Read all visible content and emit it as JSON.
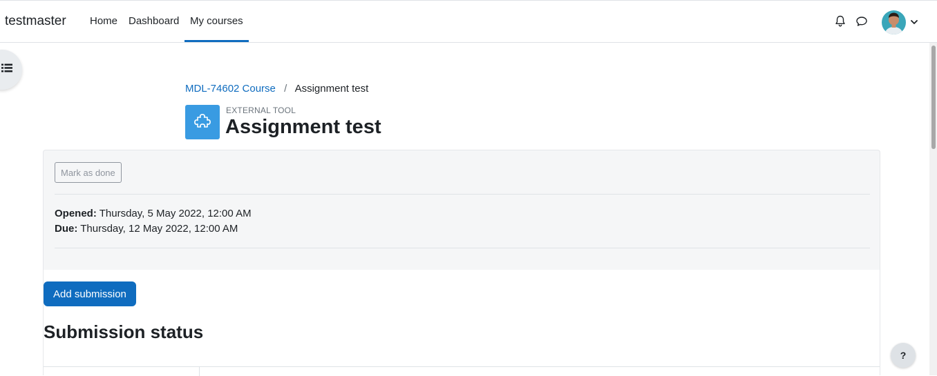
{
  "navbar": {
    "brand": "testmaster",
    "links": [
      {
        "label": "Home"
      },
      {
        "label": "Dashboard"
      },
      {
        "label": "My courses",
        "active": true
      }
    ],
    "icons": [
      "bell-icon",
      "chat-icon",
      "avatar",
      "chevron-down-icon"
    ],
    "accent_color": "#0f6cbf"
  },
  "drawer": {
    "icon": "list-icon"
  },
  "breadcrumb": {
    "course": "MDL-74602 Course",
    "separator": "/",
    "current": "Assignment test"
  },
  "activity": {
    "type": "EXTERNAL TOOL",
    "title": "Assignment test",
    "icon": "puzzle-icon",
    "icon_color": "#399be2"
  },
  "completion": {
    "mark_done_label": "Mark as done"
  },
  "dates": {
    "opened_label": "Opened:",
    "opened_value": " Thursday, 5 May 2022, 12:00 AM",
    "due_label": "Due:",
    "due_value": " Thursday, 12 May 2022, 12:00 AM"
  },
  "actions": {
    "add_submission_label": "Add submission"
  },
  "submission": {
    "heading": "Submission status"
  },
  "help": {
    "label": "?"
  }
}
